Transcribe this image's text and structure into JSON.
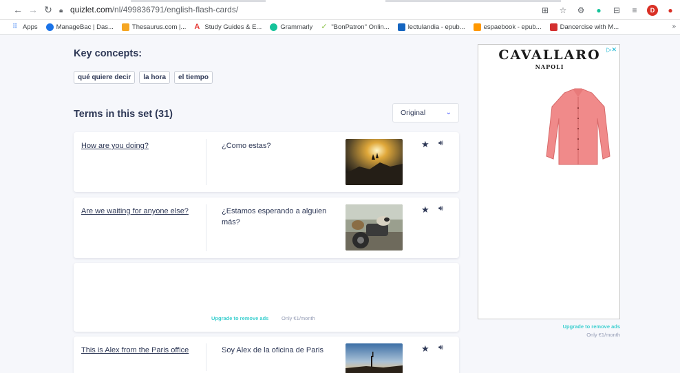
{
  "browser": {
    "url_host": "quizlet.com",
    "url_path": "/nl/499836791/english-flash-cards/",
    "bookmarks": [
      {
        "label": "Apps",
        "color": "#4285f4"
      },
      {
        "label": "ManageBac | Das...",
        "color": "#1a73e8"
      },
      {
        "label": "Thesaurus.com |...",
        "color": "#f5a623"
      },
      {
        "label": "Study Guides & E...",
        "color": "#e53935"
      },
      {
        "label": "Grammarly",
        "color": "#15c39a"
      },
      {
        "label": "\"BonPatron\" Onlin...",
        "color": "#8bc34a"
      },
      {
        "label": "lectulandia - epub...",
        "color": "#1565c0"
      },
      {
        "label": "espaebook - epub...",
        "color": "#ff9800"
      },
      {
        "label": "Dancercise with M...",
        "color": "#d32f2f"
      }
    ],
    "more": "»",
    "avatar_letter": "D"
  },
  "page": {
    "key_concepts_title": "Key concepts:",
    "chips": [
      "qué quiere decir",
      "la hora",
      "el tiempo"
    ],
    "terms_title": "Terms in this set (31)",
    "sort_value": "Original",
    "cards": [
      {
        "term": "How are you doing?",
        "definition": "¿Como estas?"
      },
      {
        "term": "Are we waiting for anyone else?",
        "definition": "¿Estamos esperando a alguien más?"
      },
      {
        "term": "This is Alex from the Paris office",
        "definition": "Soy Alex de la oficina de Paris"
      }
    ],
    "inline_ad": {
      "upgrade": "Upgrade to remove ads",
      "price": "Only €1/month"
    }
  },
  "side_ad": {
    "brand": "CAVALLARO",
    "sub": "NAPOLI",
    "upgrade": "Upgrade to remove ads",
    "price": "Only €1/month"
  }
}
